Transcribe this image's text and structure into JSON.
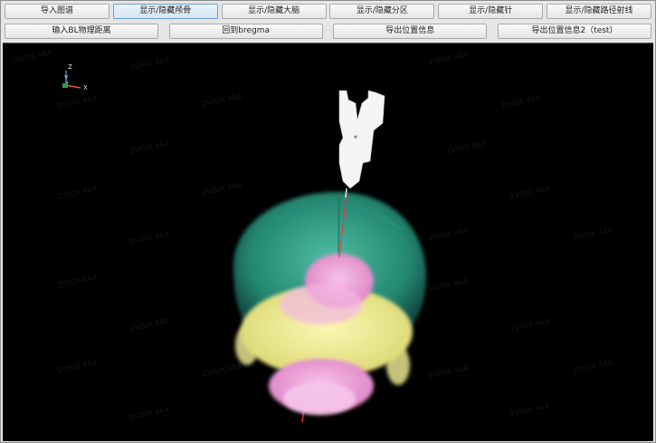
{
  "toolbar": {
    "row1": [
      {
        "label": "导入图谱"
      },
      {
        "label": "显示/隐藏颅骨",
        "active": true
      },
      {
        "label": "显示/隐藏大脑"
      },
      {
        "label": "显示/隐藏分区"
      },
      {
        "label": "显示/隐藏针"
      },
      {
        "label": "显示/隐藏路径射线"
      }
    ],
    "row2": [
      {
        "label": "输入BL物理距离"
      },
      {
        "label": "回到bregma"
      },
      {
        "label": "导出位置信息"
      },
      {
        "label": "导出位置信息2（test）"
      }
    ]
  },
  "viewport": {
    "background": "#000000",
    "axis_gizmo": {
      "x": "X",
      "y": "Y",
      "z": "Z"
    },
    "watermark_text": "2VISIX 4AA"
  },
  "colors": {
    "cortex": "#39c7a2",
    "midbrain": "#f2f08f",
    "cerebellum": "#f19ad8",
    "needle": "#ffffff",
    "path_ray": "#ff2a2a"
  }
}
